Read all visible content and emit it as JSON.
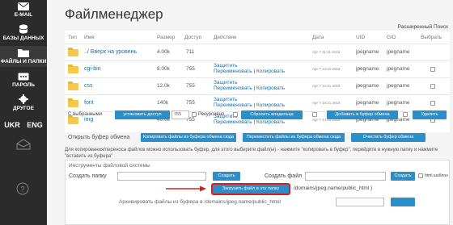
{
  "sidebar": {
    "email": "E-MAIL",
    "databases": "БАЗЫ ДАННЫХ",
    "files": "ФАЙЛЫ И ПАПКИ",
    "password": "ПАРОЛЬ",
    "other": "ДРУГОЕ",
    "lang_ukr": "UKR",
    "lang_eng": "ENG"
  },
  "header": {
    "title": "Файлменеджер",
    "advanced_search": "Расширенный Поиск"
  },
  "table": {
    "columns": [
      "Тип",
      "Имя",
      "Размер",
      "Доступ",
      "Действие",
      "Дата",
      "UID",
      "GID",
      "Выбрать"
    ],
    "rows": [
      {
        "name": "../ Вверх на уровень",
        "size": "4.00k",
        "perm": "711",
        "date": "Apr 7 21:11 2016",
        "uid": "jpegname",
        "gid": "jpegname",
        "actions": false
      },
      {
        "name": "cgi-bin",
        "size": "8.00k",
        "perm": "755",
        "date": "Apr 7 14:21 2016",
        "uid": "jpegname",
        "gid": "jpegname",
        "actions": true
      },
      {
        "name": "css",
        "size": "12.0k",
        "perm": "755",
        "date": "Apr 7 14:21 2016",
        "uid": "jpegname",
        "gid": "jpegname",
        "actions": true
      },
      {
        "name": "font",
        "size": "140k",
        "perm": "755",
        "date": "Apr 7 14:21 2016",
        "uid": "jpegname",
        "gid": "jpegname",
        "actions": true
      },
      {
        "name": "img",
        "size": "40.0k",
        "perm": "755",
        "date": "Apr 7 14:21 2016",
        "uid": "jpegname",
        "gid": "jpegname",
        "actions": true
      }
    ],
    "action_protect": "Защитить",
    "action_rename": "Переименовать",
    "action_sep": "|",
    "action_copy": "Копировать"
  },
  "bulk": {
    "selected_label": "С выбранными",
    "set_access": "установить доступ",
    "perm_value": "755",
    "recursive": "Рекурсивно",
    "reset_owner": "Сбросить владельца",
    "add_to_buffer": "Добавить в буфер обмена",
    "delete": "Удалить"
  },
  "buffer": {
    "open_label": "Открыть буфер обмена",
    "copy_files": "Копировать файлы из буфера обмена сюда",
    "move_files": "Переместить файлы из буфера обмена сюда",
    "clear": "Очистить буфер обмена",
    "note": "Для копирования/переноса файлов можно использовать буфер, для этого выберите файл(ы) - нажмите \"копировать в буфер\", перейдите в нужную папку и нажмите \"вставить из буфера\""
  },
  "tools": {
    "title": "Инструменты файловой системы",
    "create_folder_label": "Создать папку",
    "create_folder_btn": "Создать",
    "create_file_label": "Создать файл",
    "create_file_btn": "Создать",
    "html_template": "html шаблон",
    "upload_btn": "Загрузить файл в эту папку",
    "upload_path": "/domains/jpeg.name/public_html )",
    "archive_label": "Архивировать файлы из буфера в /domains/jpeg.name/public_html/"
  },
  "colors": {
    "sidebar_bg": "#2b2b2b",
    "accent": "#2a8fc9",
    "highlight": "#d32020"
  }
}
